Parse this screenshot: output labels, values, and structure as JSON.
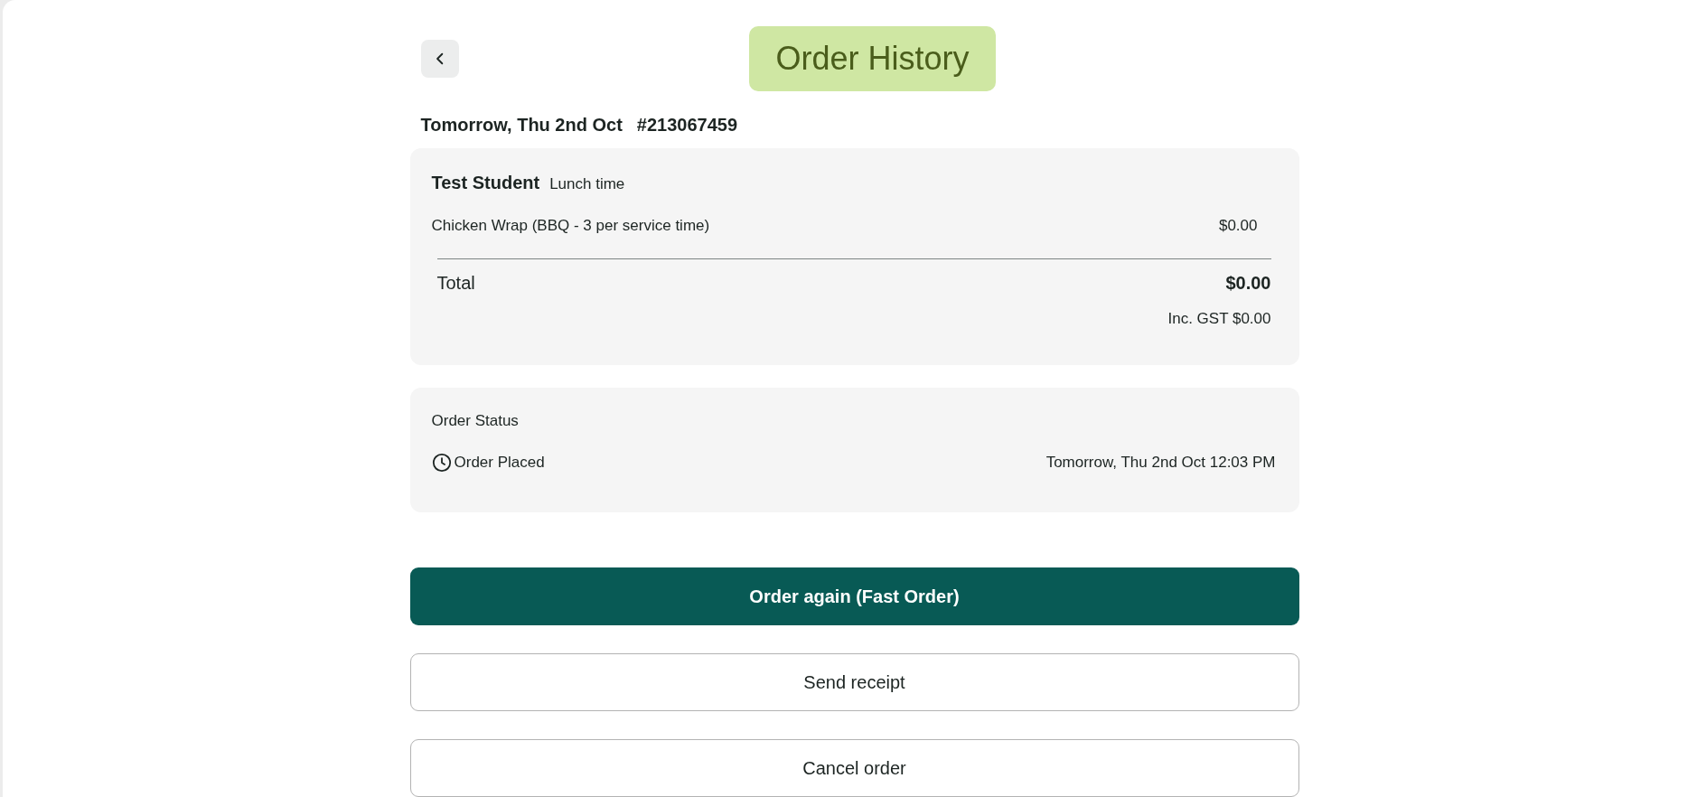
{
  "header": {
    "title": "Order History"
  },
  "order": {
    "date": "Tomorrow, Thu 2nd Oct",
    "number": "#213067459"
  },
  "summary": {
    "student": "Test Student",
    "service": "Lunch time",
    "items": [
      {
        "name": "Chicken Wrap (BBQ - 3 per service time)",
        "price": "$0.00"
      }
    ],
    "total_label": "Total",
    "total": "$0.00",
    "gst": "Inc. GST $0.00"
  },
  "status": {
    "heading": "Order Status",
    "steps": [
      {
        "label": "Order Placed",
        "time": "Tomorrow, Thu 2nd Oct 12:03 PM"
      }
    ]
  },
  "actions": [
    {
      "label": "Order again (Fast Order)",
      "kind": "primary"
    },
    {
      "label": "Send receipt",
      "kind": "outline"
    },
    {
      "label": "Cancel order",
      "kind": "outline"
    }
  ]
}
